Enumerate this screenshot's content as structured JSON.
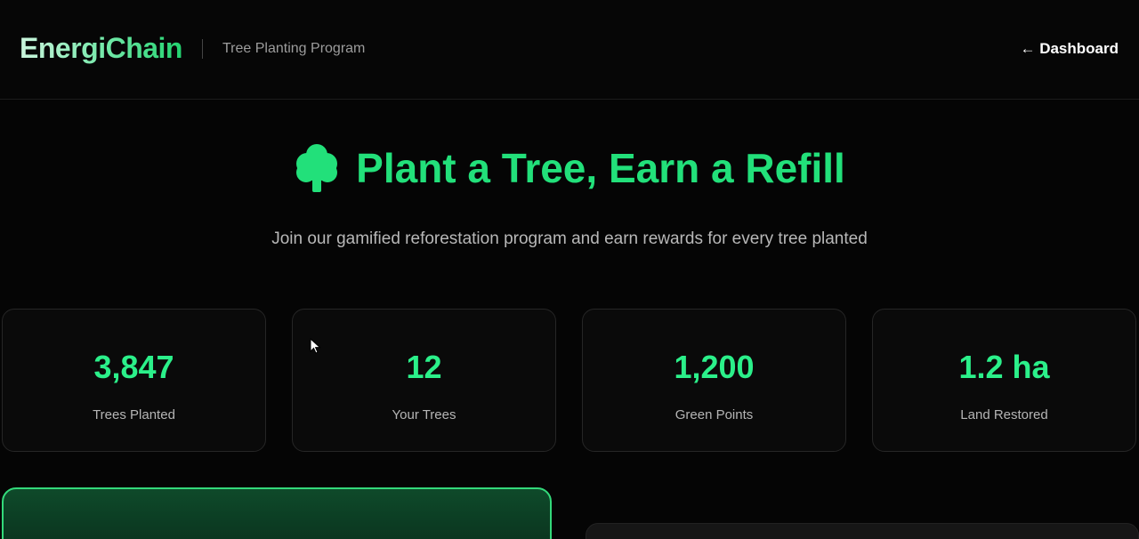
{
  "header": {
    "brand": "EnergiChain",
    "section": "Tree Planting Program",
    "back_link": "← Dashboard"
  },
  "hero": {
    "icon": "tree-icon",
    "title": "Plant a Tree, Earn a Refill",
    "description": "Join our gamified reforestation program and earn rewards for every tree planted"
  },
  "stats": [
    {
      "value": "3,847",
      "label": "Trees Planted"
    },
    {
      "value": "12",
      "label": "Your Trees"
    },
    {
      "value": "1,200",
      "label": "Green Points"
    },
    {
      "value": "1.2 ha",
      "label": "Land Restored"
    }
  ],
  "colors": {
    "accent": "#22e07a",
    "background": "#050505",
    "card_border": "#262626"
  }
}
